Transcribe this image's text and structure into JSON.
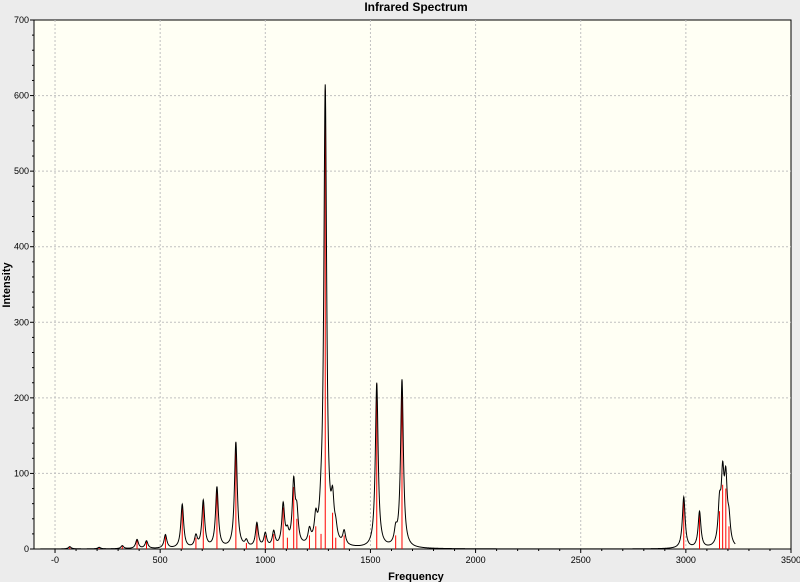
{
  "chart_data": {
    "type": "line",
    "title": "Infrared Spectrum",
    "xlabel": "Frequency",
    "ylabel": "Intensity",
    "xlim": [
      -100,
      3500
    ],
    "ylim": [
      0,
      700
    ],
    "x_ticks": [
      0,
      500,
      1000,
      1500,
      2000,
      2500,
      3000,
      3500
    ],
    "x_tick_labels": [
      "-0",
      "500",
      "1000",
      "1500",
      "2000",
      "2500",
      "3000",
      "3500"
    ],
    "y_ticks": [
      0,
      100,
      200,
      300,
      400,
      500,
      600,
      700
    ],
    "y_tick_labels": [
      "0",
      "100",
      "200",
      "300",
      "400",
      "500",
      "600",
      "700"
    ],
    "grid": true,
    "background_color": "#fffff4",
    "line_color": "#000000",
    "stick_color": "#ff0000",
    "stick_spectrum": [
      {
        "x": 70,
        "y": 3
      },
      {
        "x": 210,
        "y": 2
      },
      {
        "x": 320,
        "y": 4
      },
      {
        "x": 390,
        "y": 12
      },
      {
        "x": 435,
        "y": 10
      },
      {
        "x": 525,
        "y": 18
      },
      {
        "x": 605,
        "y": 58
      },
      {
        "x": 670,
        "y": 15
      },
      {
        "x": 705,
        "y": 62
      },
      {
        "x": 770,
        "y": 80
      },
      {
        "x": 860,
        "y": 140
      },
      {
        "x": 910,
        "y": 8
      },
      {
        "x": 960,
        "y": 32
      },
      {
        "x": 1000,
        "y": 18
      },
      {
        "x": 1040,
        "y": 20
      },
      {
        "x": 1085,
        "y": 55
      },
      {
        "x": 1105,
        "y": 15
      },
      {
        "x": 1135,
        "y": 82
      },
      {
        "x": 1150,
        "y": 40
      },
      {
        "x": 1210,
        "y": 18
      },
      {
        "x": 1240,
        "y": 30
      },
      {
        "x": 1265,
        "y": 20
      },
      {
        "x": 1285,
        "y": 607
      },
      {
        "x": 1320,
        "y": 48
      },
      {
        "x": 1335,
        "y": 15
      },
      {
        "x": 1375,
        "y": 18
      },
      {
        "x": 1530,
        "y": 218
      },
      {
        "x": 1620,
        "y": 18
      },
      {
        "x": 1650,
        "y": 222
      },
      {
        "x": 2990,
        "y": 68
      },
      {
        "x": 3065,
        "y": 48
      },
      {
        "x": 3160,
        "y": 50
      },
      {
        "x": 3175,
        "y": 85
      },
      {
        "x": 3190,
        "y": 80
      },
      {
        "x": 3205,
        "y": 30
      }
    ],
    "peak_halfwidth": 8,
    "curve_x_range": [
      -70,
      3235
    ]
  }
}
